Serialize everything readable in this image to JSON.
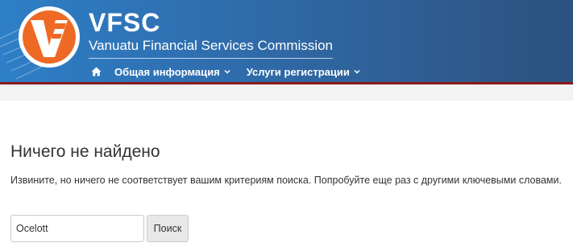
{
  "header": {
    "brand_title": "VFSC",
    "brand_subtitle": "Vanuatu Financial Services Commission",
    "colors": {
      "header_blue_light": "#2e7fc7",
      "header_blue_dark": "#2c527f",
      "accent_rule": "#8b1a1a",
      "logo_orange": "#ee6a24"
    }
  },
  "nav": {
    "home_icon": "home-icon",
    "items": [
      {
        "label": "Общая информация",
        "icon": "chevron-down-icon"
      },
      {
        "label": "Услуги регистрации",
        "icon": "chevron-down-icon"
      }
    ]
  },
  "content": {
    "title": "Ничего не найдено",
    "message": "Извините, но ничего не соответствует вашим критериям поиска. Попробуйте еще раз с другими ключевыми словами.",
    "search": {
      "value": "Ocelott",
      "button_label": "Поиск"
    }
  }
}
